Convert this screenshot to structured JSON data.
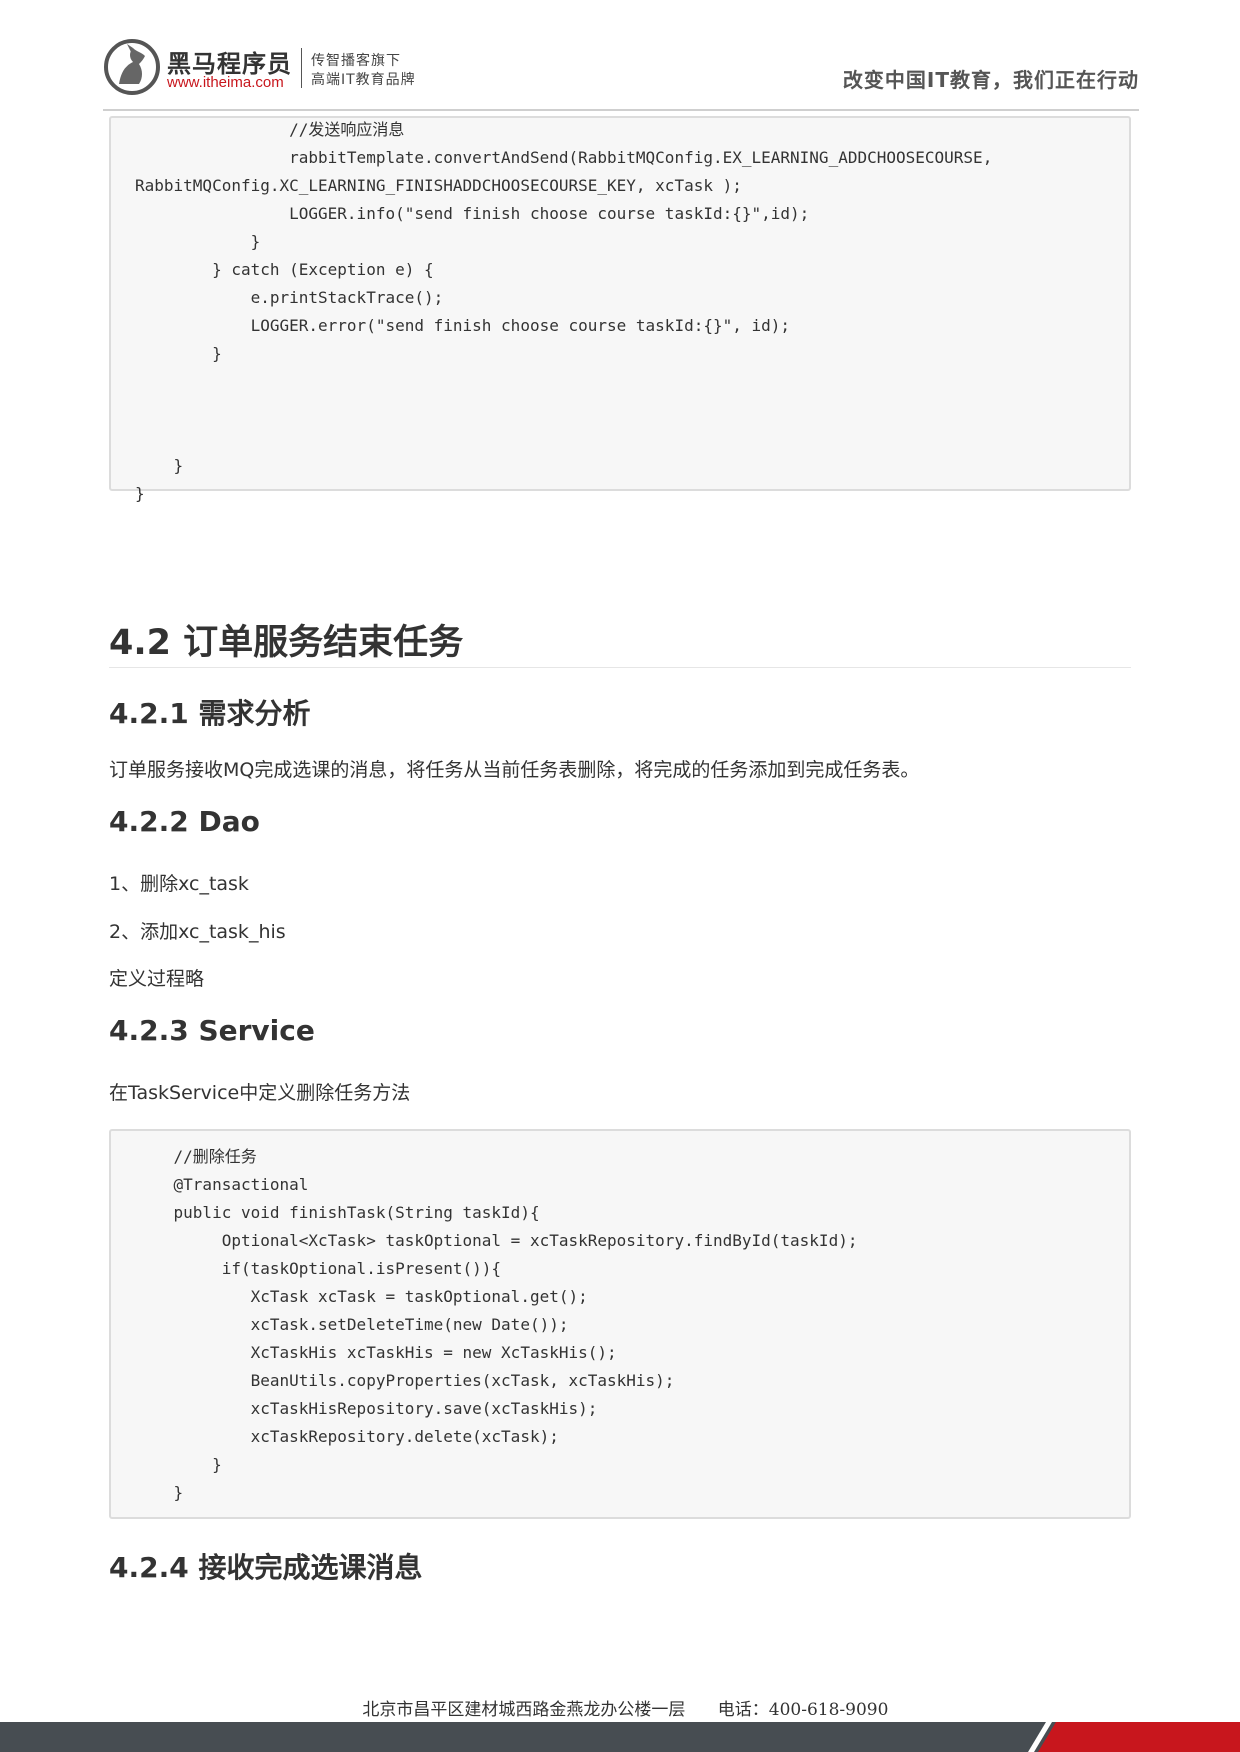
{
  "header": {
    "brand_name": "黑马程序员",
    "brand_url": "www.itheima.com",
    "slogan_line1": "传智播客旗下",
    "slogan_line2": "高端IT教育品牌",
    "motto": "改变中国IT教育，我们正在行动"
  },
  "code_block_1": {
    "lines": [
      "                //发送响应消息",
      "                rabbitTemplate.convertAndSend(RabbitMQConfig.EX_LEARNING_ADDCHOOSECOURSE,",
      "RabbitMQConfig.XC_LEARNING_FINISHADDCHOOSECOURSE_KEY, xcTask );",
      "                LOGGER.info(\"send finish choose course taskId:{}\",id);",
      "            }",
      "        } catch (Exception e) {",
      "            e.printStackTrace();",
      "            LOGGER.error(\"send finish choose course taskId:{}\", id);",
      "        }",
      "",
      "",
      "",
      "    }",
      "}"
    ]
  },
  "section_4_2": {
    "title": "4.2 订单服务结束任务"
  },
  "section_4_2_1": {
    "title": "4.2.1 需求分析",
    "text": "订单服务接收MQ完成选课的消息，将任务从当前任务表删除，将完成的任务添加到完成任务表。"
  },
  "section_4_2_2": {
    "title": "4.2.2 Dao",
    "item1": "1、删除xc_task",
    "item2": "2、添加xc_task_his",
    "note": "定义过程略"
  },
  "section_4_2_3": {
    "title": "4.2.3 Service",
    "text": "在TaskService中定义删除任务方法"
  },
  "code_block_2": {
    "lines": [
      "    //删除任务",
      "    @Transactional",
      "    public void finishTask(String taskId){",
      "         Optional<XcTask> taskOptional = xcTaskRepository.findById(taskId);",
      "         if(taskOptional.isPresent()){",
      "            XcTask xcTask = taskOptional.get();",
      "            xcTask.setDeleteTime(new Date());",
      "            XcTaskHis xcTaskHis = new XcTaskHis();",
      "            BeanUtils.copyProperties(xcTask, xcTaskHis);",
      "            xcTaskHisRepository.save(xcTaskHis);",
      "            xcTaskRepository.delete(xcTask);",
      "        }",
      "    }"
    ]
  },
  "section_4_2_4": {
    "title": "4.2.4 接收完成选课消息"
  },
  "footer": {
    "address": "北京市昌平区建材城西路金燕龙办公楼一层",
    "phone": "电话：400-618-9090"
  },
  "colors": {
    "brand_red": "#c8161d",
    "footer_dark": "#474d52",
    "code_bg": "#f7f7f7"
  }
}
